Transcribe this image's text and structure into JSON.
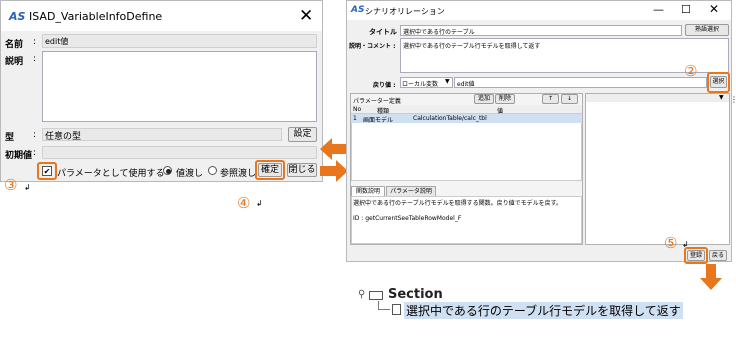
{
  "left_dialog": {
    "title": "ISAD_VariableInfoDefine",
    "name_label": "名前",
    "name_value": "edit値",
    "desc_label": "説明",
    "type_label": "型",
    "type_value": "任意の型",
    "set_button": "設定",
    "initial_label": "初期値",
    "colon": ":",
    "use_as_param": "パラメータとして使用する",
    "by_value": "値渡し",
    "by_reference": "参照渡し",
    "confirm_button": "確定",
    "close_button": "閉じる"
  },
  "right_dialog": {
    "title": "シナリオリレーション",
    "title_label": "タイトル :",
    "title_value": "選択中である行のテーブル",
    "manage_button": "熟語選択",
    "desc_label": "説明・コメント :",
    "desc_value": "選択中である行のテーブル行モデルを取得して返す",
    "return_label": "戻り値 :",
    "return_type": "ローカル変数",
    "return_value": "edit値",
    "select_button": "選択",
    "param_header": "パラメーター定義",
    "add_button": "追加",
    "delete_button": "削除",
    "up_button": "↑",
    "down_button": "↓",
    "col_no": "No",
    "col_kind": "種類",
    "col_value": "値",
    "row_no": "1",
    "row_kind": "画面モデル",
    "row_value": "CalculationTable/calc_tbl",
    "tab_function": "関数説明",
    "tab_param": "パラメータ説明",
    "func_desc": "選択中である行のテーブル行モデルを取得する関数。戻り値でモデルを戻す。",
    "func_id": "ID : getCurrentSeeTableRowModel_F",
    "register_button": "登録",
    "back_button": "戻る"
  },
  "steps": {
    "s2": "②",
    "s3": "③",
    "s4": "④",
    "s5": "⑤"
  },
  "tree": {
    "root": "Section",
    "child": "選択中である行のテーブル行モデルを取得して返す"
  },
  "colors": {
    "accent": "#e8761d",
    "selection": "#cfe0f3"
  }
}
